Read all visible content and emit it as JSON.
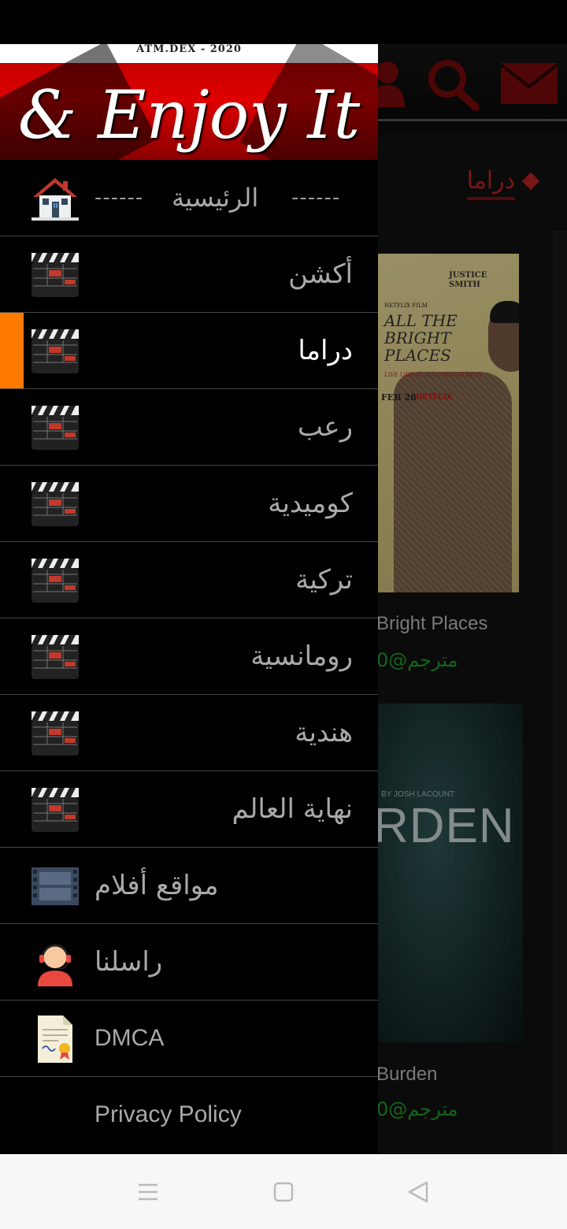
{
  "app": {
    "section_title": "دراما",
    "movies": [
      {
        "name": "Bright Places",
        "tag": "مترجم@0"
      },
      {
        "name": "Burden",
        "tag": "مترجم@0"
      }
    ],
    "posters": [
      {
        "author": "JUSTICE SMITH",
        "brand": "NETFLIX FILM",
        "title": "ALL THE BRIGHT PLACES",
        "tagline": "LIVE LIFE AT FULL BRIGHTNESS",
        "date": "FEB 28",
        "network": "NETFLIX"
      },
      {
        "credit": "BY JOSH LACOUNT",
        "title": "RDEN"
      }
    ]
  },
  "drawer": {
    "banner": {
      "top_text": "ATM.DEX - 2020",
      "title": "& Enjoy It"
    },
    "home": {
      "label": "الرئيسية",
      "dashes_left": "------",
      "dashes_right": "------"
    },
    "categories": [
      {
        "label": "أكشن",
        "active": false
      },
      {
        "label": "دراما",
        "active": true
      },
      {
        "label": "رعب",
        "active": false
      },
      {
        "label": "كوميدية",
        "active": false
      },
      {
        "label": "تركية",
        "active": false
      },
      {
        "label": "رومانسية",
        "active": false
      },
      {
        "label": "هندية",
        "active": false
      },
      {
        "label": "نهاية العالم",
        "active": false
      }
    ],
    "extras": [
      {
        "label": "مواقع أفلام",
        "icon": "film-strip-icon"
      },
      {
        "label": "راسلنا",
        "icon": "support-agent-icon"
      },
      {
        "label": "DMCA",
        "icon": "certificate-icon"
      },
      {
        "label": "Privacy Policy",
        "icon": ""
      }
    ]
  },
  "colors": {
    "accent": "#ff7a00",
    "brand_red": "#b22222",
    "tag_green": "#1f9a2a"
  }
}
